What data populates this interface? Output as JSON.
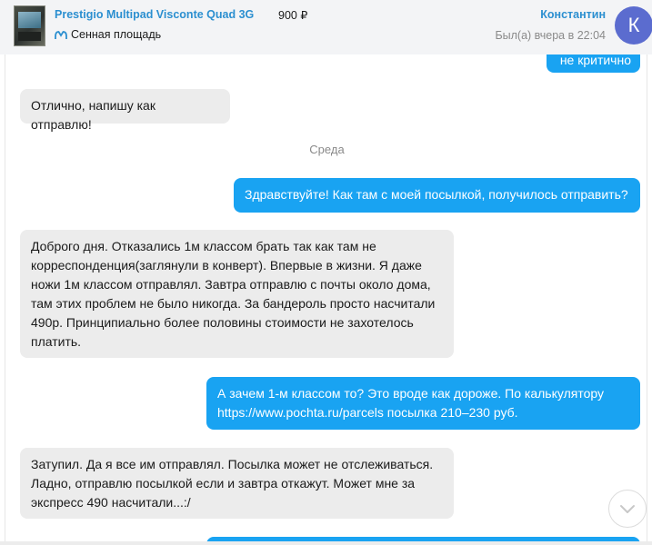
{
  "header": {
    "item_title": "Prestigio Multipad Visconte Quad 3G",
    "price": "900 ₽",
    "metro_station": "Сенная площадь",
    "metro_icon": "metro-icon",
    "user_name": "Константин",
    "last_seen": "Был(а) вчера в 22:04",
    "avatar_letter": "К",
    "accent_color": "#2b8fd0",
    "avatar_color": "#5b6ccf"
  },
  "messages": [
    {
      "side": "out",
      "text": "не критично"
    },
    {
      "side": "in",
      "text": "Отлично, напишу как отправлю!"
    },
    {
      "side": "separator",
      "text": "Среда"
    },
    {
      "side": "out",
      "text": "Здравствуйте! Как там с моей посылкой, получилось отправить?"
    },
    {
      "side": "in",
      "lines": [
        "Доброго дня. Отказались 1м классом брать так как там не",
        "корреспонденция(заглянули в конверт). Впервые в жизни. Я даже",
        "ножи 1м классом отправлял. Завтра отправлю с почты около дома,",
        "там этих проблем не было никогда. За бандероль просто насчитали",
        "490р. Принципиально более половины стоимости не захотелось",
        "платить."
      ]
    },
    {
      "side": "out",
      "lines": [
        "А зачем 1-м классом то? Это вроде как дороже. По калькулятору",
        "https://www.pochta.ru/parcels посылка 210–230 руб."
      ]
    },
    {
      "side": "in",
      "lines": [
        "Затупил. Да я все им отправлял. Посылка может не отслеживаться.",
        "Ладно, отправлю посылкой если и завтра откажут. Может мне за",
        "экспресс 490 насчитали...:/"
      ]
    }
  ],
  "controls": {
    "scroll_down_icon": "chevron-down-icon"
  },
  "colors": {
    "outgoing_bubble": "#19a3f2",
    "incoming_bubble": "#ececec"
  }
}
